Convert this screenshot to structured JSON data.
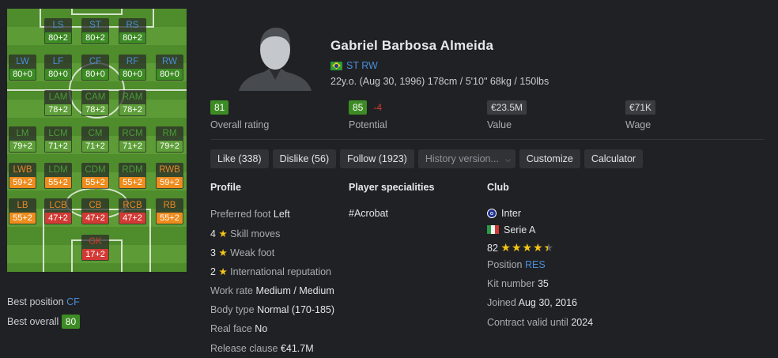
{
  "pitch": {
    "rows": [
      [
        {
          "code": "LS",
          "rating": "80+2",
          "color": "blue",
          "rcolor": "green",
          "slot": 1
        },
        {
          "code": "ST",
          "rating": "80+2",
          "color": "blue",
          "rcolor": "green",
          "slot": 2
        },
        {
          "code": "RS",
          "rating": "80+2",
          "color": "blue",
          "rcolor": "green",
          "slot": 3
        }
      ],
      [
        {
          "code": "LW",
          "rating": "80+0",
          "color": "blue",
          "rcolor": "green",
          "slot": 0
        },
        {
          "code": "LF",
          "rating": "80+0",
          "color": "blue",
          "rcolor": "green",
          "slot": 1
        },
        {
          "code": "CF",
          "rating": "80+0",
          "color": "blue",
          "rcolor": "green",
          "slot": 2
        },
        {
          "code": "RF",
          "rating": "80+0",
          "color": "blue",
          "rcolor": "green",
          "slot": 3
        },
        {
          "code": "RW",
          "rating": "80+0",
          "color": "blue",
          "rcolor": "green",
          "slot": 4
        }
      ],
      [
        {
          "code": "LAM",
          "rating": "78+2",
          "color": "green",
          "rcolor": "lgreen",
          "slot": 1
        },
        {
          "code": "CAM",
          "rating": "78+2",
          "color": "green",
          "rcolor": "lgreen",
          "slot": 2
        },
        {
          "code": "RAM",
          "rating": "78+2",
          "color": "green",
          "rcolor": "lgreen",
          "slot": 3
        }
      ],
      [
        {
          "code": "LM",
          "rating": "79+2",
          "color": "green",
          "rcolor": "lgreen",
          "slot": 0
        },
        {
          "code": "LCM",
          "rating": "71+2",
          "color": "green",
          "rcolor": "lgreen",
          "slot": 1
        },
        {
          "code": "CM",
          "rating": "71+2",
          "color": "green",
          "rcolor": "lgreen",
          "slot": 2
        },
        {
          "code": "RCM",
          "rating": "71+2",
          "color": "green",
          "rcolor": "lgreen",
          "slot": 3
        },
        {
          "code": "RM",
          "rating": "79+2",
          "color": "green",
          "rcolor": "lgreen",
          "slot": 4
        }
      ],
      [
        {
          "code": "LWB",
          "rating": "59+2",
          "color": "orange",
          "rcolor": "orange",
          "slot": 0
        },
        {
          "code": "LDM",
          "rating": "55+2",
          "color": "green",
          "rcolor": "orange",
          "slot": 1
        },
        {
          "code": "CDM",
          "rating": "55+2",
          "color": "green",
          "rcolor": "orange",
          "slot": 2
        },
        {
          "code": "RDM",
          "rating": "55+2",
          "color": "green",
          "rcolor": "orange",
          "slot": 3
        },
        {
          "code": "RWB",
          "rating": "59+2",
          "color": "orange",
          "rcolor": "orange",
          "slot": 4
        }
      ],
      [
        {
          "code": "LB",
          "rating": "55+2",
          "color": "orange",
          "rcolor": "orange",
          "slot": 0
        },
        {
          "code": "LCB",
          "rating": "47+2",
          "color": "orange",
          "rcolor": "red",
          "slot": 1
        },
        {
          "code": "CB",
          "rating": "47+2",
          "color": "orange",
          "rcolor": "red",
          "slot": 2
        },
        {
          "code": "RCB",
          "rating": "47+2",
          "color": "orange",
          "rcolor": "red",
          "slot": 3
        },
        {
          "code": "RB",
          "rating": "55+2",
          "color": "orange",
          "rcolor": "orange",
          "slot": 4
        }
      ],
      [
        {
          "code": "GK",
          "rating": "17+2",
          "color": "red",
          "rcolor": "red",
          "slot": 2
        }
      ]
    ]
  },
  "best": {
    "position_label": "Best position",
    "position_value": "CF",
    "overall_label": "Best overall",
    "overall_value": "80"
  },
  "player": {
    "name": "Gabriel Barbosa Almeida",
    "positions": "ST RW",
    "bio": "22y.o. (Aug 30, 1996) 178cm / 5'10\" 68kg / 150lbs"
  },
  "stats": {
    "overall": {
      "value": "81",
      "label": "Overall rating"
    },
    "potential": {
      "value": "85",
      "delta": "-4",
      "label": "Potential"
    },
    "value": {
      "value": "€23.5M",
      "label": "Value"
    },
    "wage": {
      "value": "€71K",
      "label": "Wage"
    }
  },
  "buttons": {
    "like": "Like (338)",
    "dislike": "Dislike (56)",
    "follow": "Follow (1923)",
    "history": "History version...",
    "customize": "Customize",
    "calculator": "Calculator"
  },
  "profile": {
    "title": "Profile",
    "preferred_foot_label": "Preferred foot",
    "preferred_foot": "Left",
    "skill_moves_num": "4",
    "skill_moves_label": "Skill moves",
    "weak_foot_num": "3",
    "weak_foot_label": "Weak foot",
    "intl_rep_num": "2",
    "intl_rep_label": "International reputation",
    "work_rate_label": "Work rate",
    "work_rate": "Medium / Medium",
    "body_type_label": "Body type",
    "body_type": "Normal (170-185)",
    "real_face_label": "Real face",
    "real_face": "No",
    "release_clause_label": "Release clause",
    "release_clause": "€41.7M"
  },
  "specialities": {
    "title": "Player specialities",
    "items": [
      "#Acrobat"
    ]
  },
  "club": {
    "title": "Club",
    "name": "Inter",
    "league": "Serie A",
    "rating": "82",
    "stars": 4.5,
    "position_label": "Position",
    "position": "RES",
    "kit_label": "Kit number",
    "kit": "35",
    "joined_label": "Joined",
    "joined": "Aug 30, 2016",
    "contract_label": "Contract valid until",
    "contract": "2024"
  }
}
